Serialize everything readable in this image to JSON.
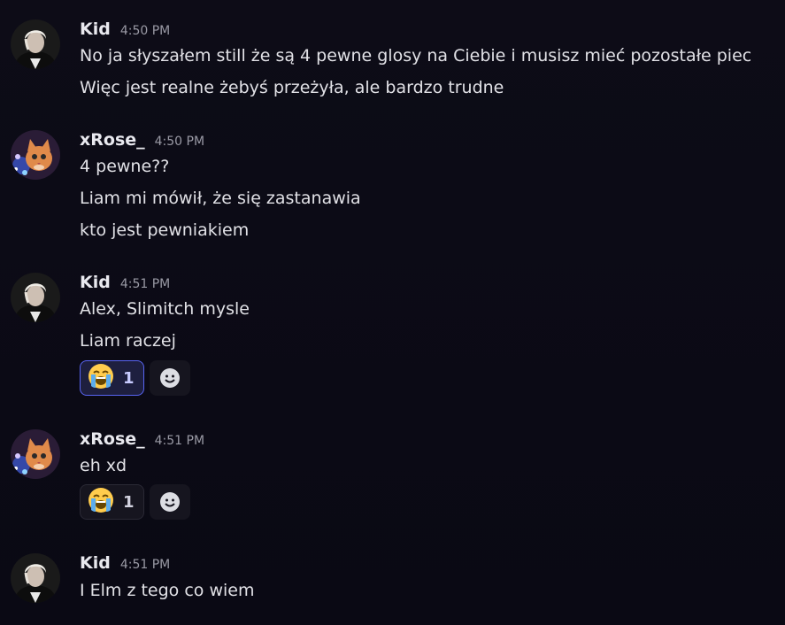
{
  "messages": [
    {
      "username": "Kid",
      "time": "4:50 PM",
      "avatar_icon": "kid-avatar",
      "lines": [
        "No ja słyszałem still że są 4 pewne glosy na Ciebie i musisz mieć pozostałe piec",
        "Więc jest realne żebyś przeżyła, ale bardzo trudne"
      ]
    },
    {
      "username": "xRose_",
      "time": "4:50 PM",
      "avatar_icon": "cat-avatar",
      "lines": [
        "4 pewne??",
        "Liam mi mówił, że się zastanawia",
        "kto jest pewniakiem"
      ]
    },
    {
      "username": "Kid",
      "time": "4:51 PM",
      "avatar_icon": "kid-avatar",
      "lines": [
        "Alex, Slimitch mysle",
        "Liam raczej"
      ],
      "reaction": {
        "emoji": "😭",
        "count": "1",
        "reacted_by_me": true
      }
    },
    {
      "username": "xRose_",
      "time": "4:51 PM",
      "avatar_icon": "cat-avatar",
      "lines": [
        "eh xd"
      ],
      "reaction": {
        "emoji": "😭",
        "count": "1",
        "reacted_by_me": false
      }
    },
    {
      "username": "Kid",
      "time": "4:51 PM",
      "avatar_icon": "kid-avatar",
      "lines": [
        "I Elm z tego co wiem"
      ]
    }
  ],
  "add_reaction_icon": "smiley-add-reaction-icon",
  "colors": {
    "background": "#0c0b16",
    "accent": "#5864f2"
  }
}
